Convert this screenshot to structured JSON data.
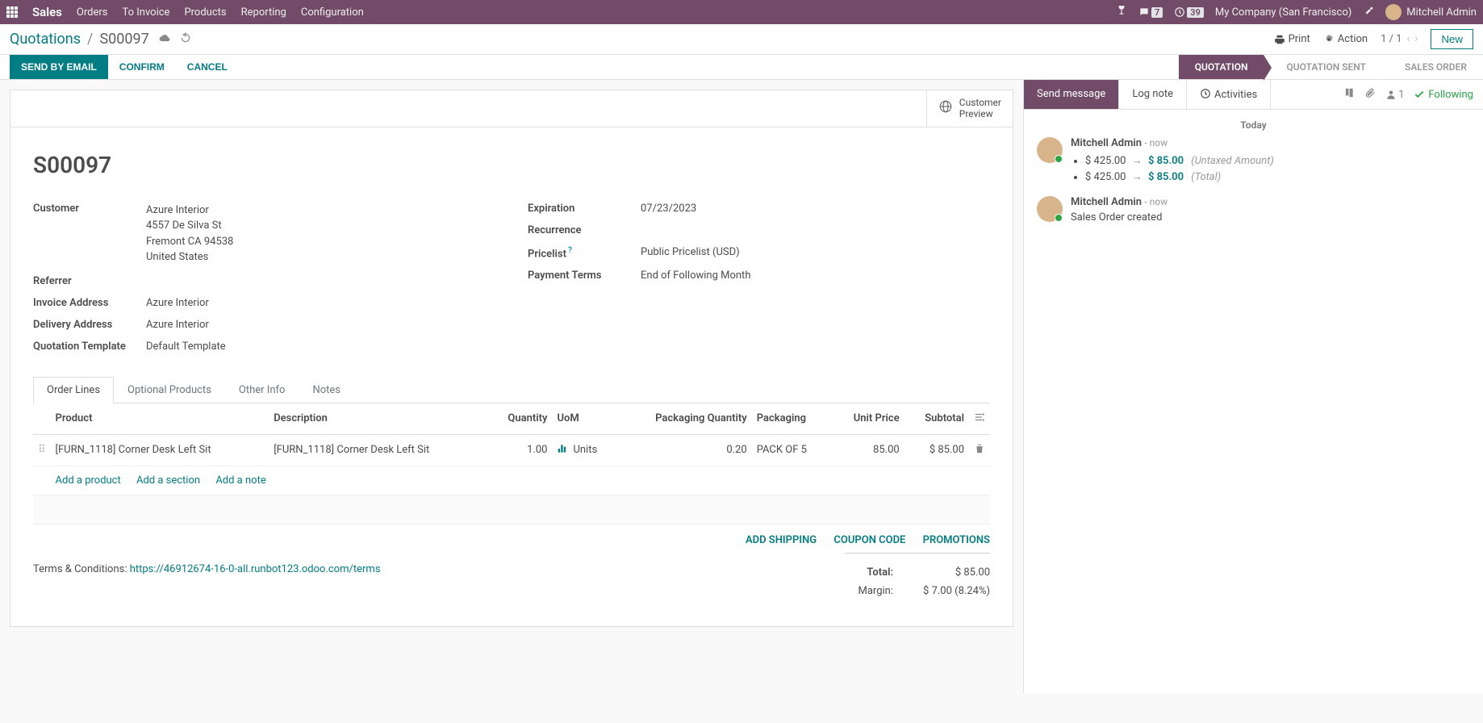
{
  "topbar": {
    "brand": "Sales",
    "menu": [
      "Orders",
      "To Invoice",
      "Products",
      "Reporting",
      "Configuration"
    ],
    "discuss_count": "7",
    "clock_count": "39",
    "company": "My Company (San Francisco)",
    "user": "Mitchell Admin"
  },
  "breadcrumb": {
    "root": "Quotations",
    "current": "S00097"
  },
  "controls": {
    "print": "Print",
    "action": "Action",
    "pager": "1 / 1",
    "new": "New"
  },
  "status_buttons": {
    "send": "SEND BY EMAIL",
    "confirm": "CONFIRM",
    "cancel": "CANCEL"
  },
  "status_steps": [
    "QUOTATION",
    "QUOTATION SENT",
    "SALES ORDER"
  ],
  "preview_label": "Customer\nPreview",
  "record": {
    "name": "S00097",
    "customer_label": "Customer",
    "customer_name": "Azure Interior",
    "customer_addr": [
      "4557 De Silva St",
      "Fremont CA 94538",
      "United States"
    ],
    "referrer_label": "Referrer",
    "invoice_label": "Invoice Address",
    "invoice_val": "Azure Interior",
    "delivery_label": "Delivery Address",
    "delivery_val": "Azure Interior",
    "template_label": "Quotation Template",
    "template_val": "Default Template",
    "expiration_label": "Expiration",
    "expiration_val": "07/23/2023",
    "recurrence_label": "Recurrence",
    "pricelist_label": "Pricelist",
    "pricelist_val": "Public Pricelist (USD)",
    "terms_label": "Payment Terms",
    "terms_val": "End of Following Month"
  },
  "tabs": [
    "Order Lines",
    "Optional Products",
    "Other Info",
    "Notes"
  ],
  "table": {
    "headers": {
      "product": "Product",
      "description": "Description",
      "qty": "Quantity",
      "uom": "UoM",
      "pkg_qty": "Packaging Quantity",
      "pkg": "Packaging",
      "unit_price": "Unit Price",
      "subtotal": "Subtotal"
    },
    "rows": [
      {
        "product": "[FURN_1118] Corner Desk Left Sit",
        "description": "[FURN_1118] Corner Desk Left Sit",
        "qty": "1.00",
        "uom": "Units",
        "pkg_qty": "0.20",
        "pkg": "PACK OF 5",
        "unit_price": "85.00",
        "subtotal": "$ 85.00"
      }
    ],
    "add_product": "Add a product",
    "add_section": "Add a section",
    "add_note": "Add a note"
  },
  "bottom_actions": {
    "shipping": "ADD SHIPPING",
    "coupon": "COUPON CODE",
    "promo": "PROMOTIONS"
  },
  "terms": {
    "label": "Terms & Conditions: ",
    "link": "https://46912674-16-0-all.runbot123.odoo.com/terms"
  },
  "totals": {
    "total_label": "Total:",
    "total_val": "$ 85.00",
    "margin_label": "Margin:",
    "margin_val": "$ 7.00 (8.24%)"
  },
  "chatter": {
    "send": "Send message",
    "log": "Log note",
    "activities": "Activities",
    "follower_count": "1",
    "following": "Following",
    "today": "Today",
    "messages": [
      {
        "author": "Mitchell Admin",
        "when": "now",
        "changes": [
          {
            "old": "$ 425.00",
            "new": "$ 85.00",
            "field": "(Untaxed Amount)"
          },
          {
            "old": "$ 425.00",
            "new": "$ 85.00",
            "field": "(Total)"
          }
        ]
      },
      {
        "author": "Mitchell Admin",
        "when": "now",
        "body": "Sales Order created"
      }
    ]
  }
}
